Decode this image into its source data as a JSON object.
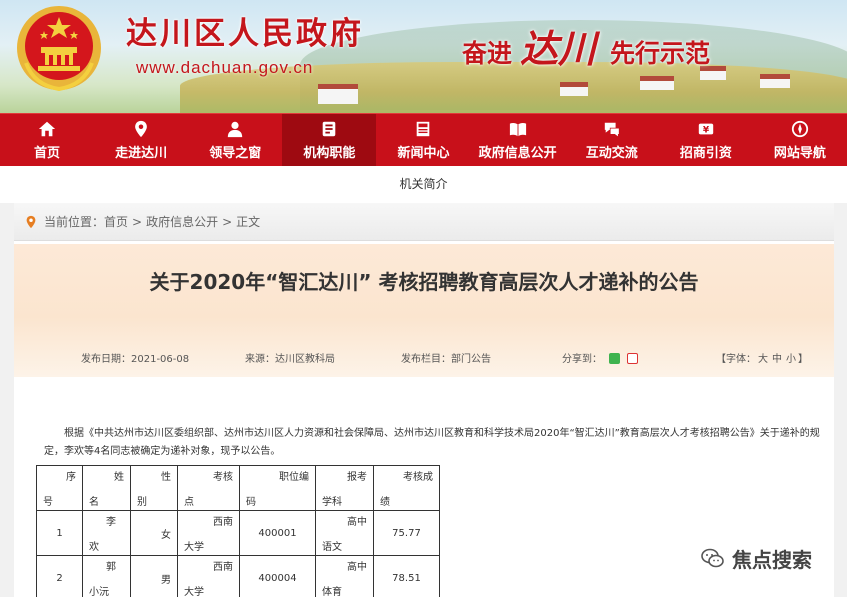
{
  "header": {
    "site_name": "达川区人民政府",
    "site_url": "www.dachuan.gov.cn",
    "slogan_part1": "奋进",
    "slogan_part2": "达川",
    "slogan_part3": "先行示范"
  },
  "nav": {
    "items": [
      {
        "label": "首页",
        "icon": "home-icon"
      },
      {
        "label": "走进达川",
        "icon": "location-icon"
      },
      {
        "label": "领导之窗",
        "icon": "person-icon"
      },
      {
        "label": "机构职能",
        "icon": "org-icon",
        "active": true
      },
      {
        "label": "新闻中心",
        "icon": "news-icon"
      },
      {
        "label": "政府信息公开",
        "icon": "book-icon"
      },
      {
        "label": "互动交流",
        "icon": "chat-icon"
      },
      {
        "label": "招商引资",
        "icon": "money-icon"
      },
      {
        "label": "网站导航",
        "icon": "compass-icon"
      }
    ]
  },
  "subtab": {
    "label": "机关简介"
  },
  "breadcrumb": {
    "prefix": "当前位置：",
    "items": [
      "首页",
      "政府信息公开",
      "正文"
    ],
    "sep": ">"
  },
  "article": {
    "title": "关于2020年“智汇达川” 考核招聘教育高层次人才递补的公告",
    "publish_date": "发布日期：2021-06-08",
    "source": "来源：达川区教科局",
    "column": "发布栏目：部门公告",
    "share_label": "分享到：",
    "font_prefix": "【字体：",
    "font_large": "大",
    "font_medium": "中",
    "font_small": "小",
    "font_suffix": "】",
    "paragraph": "根据《中共达州市达川区委组织部、达州市达川区人力资源和社会保障局、达州市达川区教育和科学技术局2020年“智汇达川”教育高层次人才考核招聘公告》关于递补的规定，李欢等4名同志被确定为递补对象，现予以公告。"
  },
  "table": {
    "headers": [
      {
        "top": "序",
        "bottom": "号"
      },
      {
        "top": "姓",
        "bottom": "名"
      },
      {
        "top": "性",
        "bottom": "别"
      },
      {
        "top": "考核",
        "bottom": "点"
      },
      {
        "top": "职位编",
        "bottom": "码"
      },
      {
        "top": "报考",
        "bottom": "学科"
      },
      {
        "top": "考核成",
        "bottom": "绩"
      }
    ],
    "rows": [
      {
        "no": "1",
        "name_top": "李",
        "name_bottom": "欢",
        "gender": "女",
        "site_top": "西南",
        "site_bottom": "大学",
        "code": "400001",
        "subject_top": "高中",
        "subject_bottom": "语文",
        "score": "75.77"
      },
      {
        "no": "2",
        "name_top": "郭",
        "name_bottom": "小沅",
        "gender": "男",
        "site_top": "西南",
        "site_bottom": "大学",
        "code": "400004",
        "subject_top": "高中",
        "subject_bottom": "体育",
        "score": "78.51"
      }
    ]
  },
  "watermark": {
    "text": "焦点搜索"
  },
  "colors": {
    "primary_red": "#c8101a",
    "active_nav": "#9e0a11",
    "title_bg": "#fbe5cf"
  }
}
